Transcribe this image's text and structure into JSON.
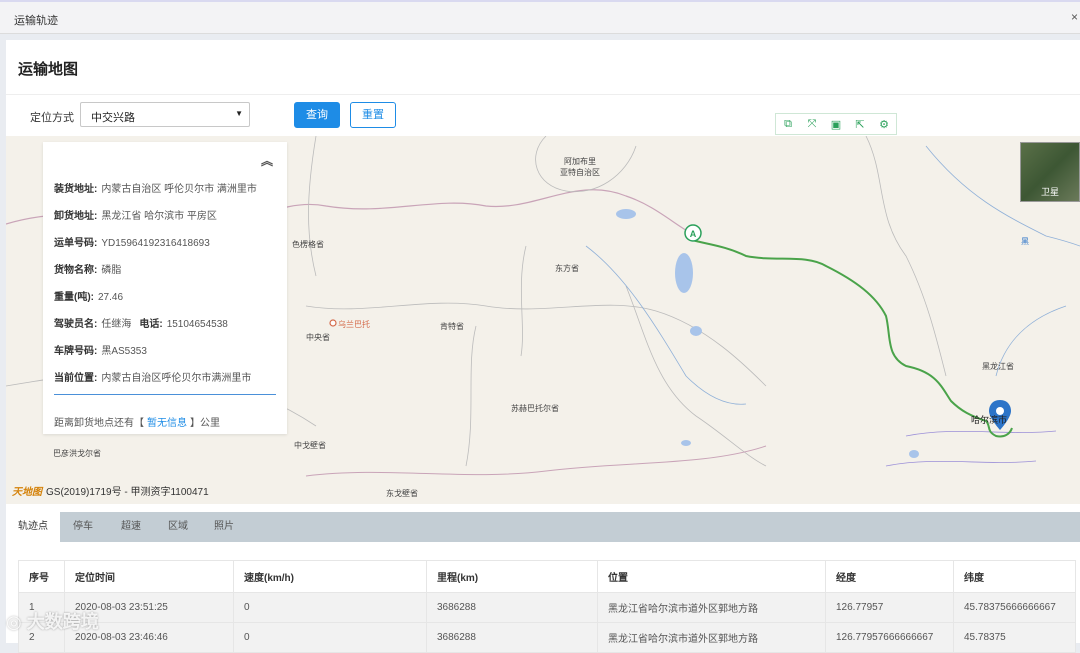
{
  "window": {
    "title": "运输轨迹",
    "close": "×"
  },
  "page": {
    "heading": "运输地图"
  },
  "form": {
    "positioning_label": "定位方式",
    "positioning_value": "中交兴路",
    "query_label": "查询",
    "reset_label": "重置"
  },
  "map": {
    "satellite_label": "卫星",
    "copyright": "GS(2019)1719号 - 甲测资字1100471",
    "copyright_brand": "天地图",
    "start_marker": "A",
    "place_labels": [
      "阿加布里",
      "亚特自治区",
      "色楞格省",
      "东方省",
      "乌兰巴托",
      "中央省",
      "肯特省",
      "苏赫巴托尔省",
      "中戈壁省",
      "巴彦洪戈尔省",
      "东戈壁省",
      "黑龙江省",
      "哈尔滨市",
      "黑"
    ]
  },
  "info": {
    "load_label": "装货地址:",
    "load_value": "内蒙古自治区 呼伦贝尔市 满洲里市",
    "unload_label": "卸货地址:",
    "unload_value": "黑龙江省 哈尔滨市 平房区",
    "waybill_label": "运单号码:",
    "waybill_value": "YD15964192316418693",
    "goods_label": "货物名称:",
    "goods_value": "磷脂",
    "weight_label": "重量(吨):",
    "weight_value": "27.46",
    "driver_label": "驾驶员名:",
    "driver_value": "任继海",
    "phone_label": "电话:",
    "phone_value": "15104654538",
    "plate_label": "车牌号码:",
    "plate_value": "黑AS5353",
    "location_label": "当前位置:",
    "location_value": "内蒙古自治区呼伦贝尔市满洲里市",
    "distance_prefix": "距离卸货地点还有【",
    "distance_value": "暂无信息",
    "distance_suffix": "】公里"
  },
  "tabs": [
    "轨迹点",
    "停车",
    "超速",
    "区域",
    "照片"
  ],
  "table": {
    "headers": [
      "序号",
      "定位时间",
      "速度(km/h)",
      "里程(km)",
      "位置",
      "经度",
      "纬度"
    ],
    "rows": [
      [
        "1",
        "2020-08-03 23:51:25",
        "0",
        "3686288",
        "黑龙江省哈尔滨市道外区郭地方路",
        "126.77957",
        "45.78375666666667"
      ],
      [
        "2",
        "2020-08-03 23:46:46",
        "0",
        "3686288",
        "黑龙江省哈尔滨市道外区郭地方路",
        "126.77957666666667",
        "45.78375"
      ]
    ]
  },
  "watermark": "大数跨境",
  "colors": {
    "primary": "#1e8ce6",
    "route": "#4aa34a",
    "map_bg": "#f4f1ea",
    "tabbar": "#c3cdd4"
  }
}
